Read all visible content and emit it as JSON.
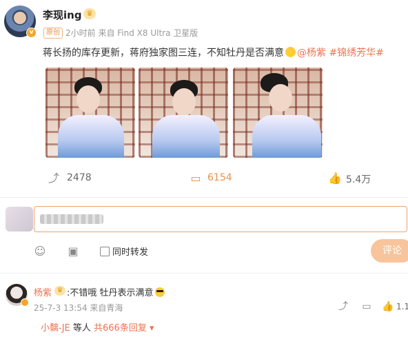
{
  "post": {
    "author": "李现ing",
    "badge_original": "原创",
    "time_source": "2小时前 来自 Find X8 Ultra 卫星版",
    "text_main": "蒋长扬的库存更新，蒋府独家图三连，不知牡丹是否满意",
    "mention": "@杨紫",
    "topic": "#锦绣芳华#",
    "repost_count": "2478",
    "comment_count": "6154",
    "like_count": "5.4万"
  },
  "composer": {
    "sync_label": "同时转发",
    "submit_label": "评论"
  },
  "comment": {
    "author": "杨紫",
    "text": ":不错哦 牡丹表示满意",
    "time_source": "25-7-3 13:54 来自青海",
    "like_count": "1.1",
    "reply_user": "小黐-JE",
    "reply_mid": " 等人 ",
    "reply_total": "共666条回复"
  },
  "icons": {
    "repost": "repost-icon",
    "comment": "comment-icon",
    "like": "like-icon",
    "emoji": "emoji-icon",
    "image": "image-icon",
    "dropdown": "chevron-down-icon"
  },
  "colors": {
    "accent": "#eb7350",
    "submit_bg": "#f8c49c",
    "verified": "#f4a52b"
  }
}
